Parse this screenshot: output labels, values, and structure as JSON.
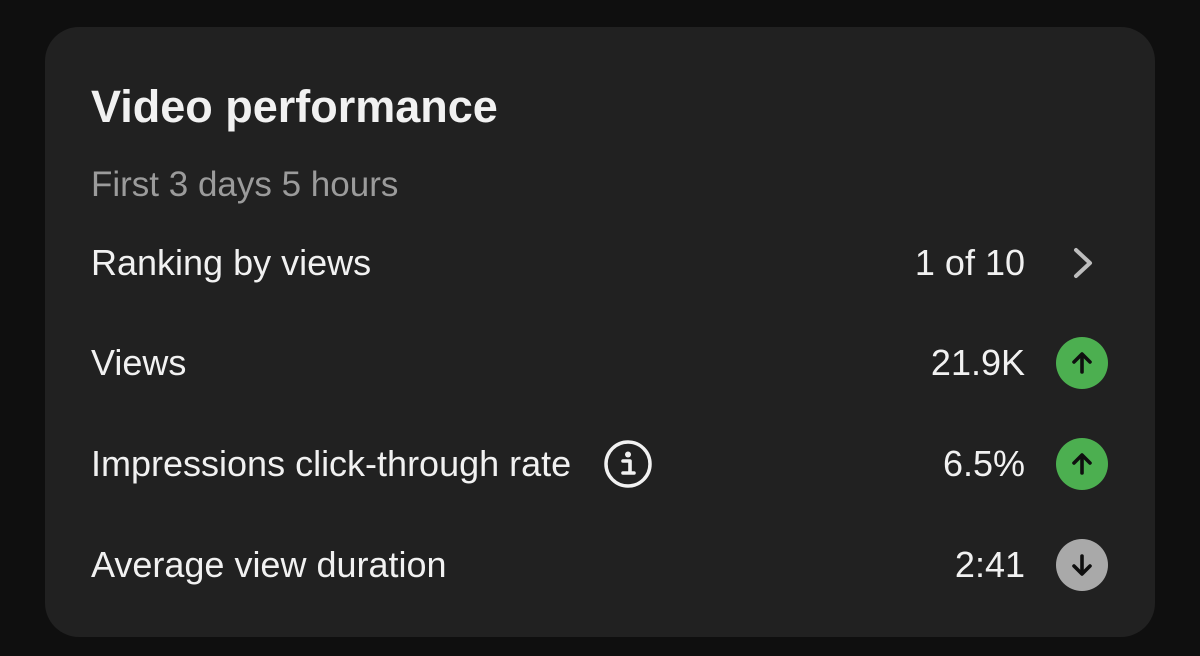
{
  "card": {
    "title": "Video performance",
    "subtitle": "First 3 days 5 hours"
  },
  "rows": [
    {
      "label": "Ranking by views",
      "value": "1 of 10",
      "icon": "chevron-right-icon"
    },
    {
      "label": "Views",
      "value": "21.9K",
      "trend": "up",
      "icon": "arrow-up-icon"
    },
    {
      "label": "Impressions click-through rate",
      "value": "6.5%",
      "trend": "up",
      "icon": "arrow-up-icon",
      "info_icon": "info-icon"
    },
    {
      "label": "Average view duration",
      "value": "2:41",
      "trend": "down",
      "icon": "arrow-down-icon"
    }
  ],
  "colors": {
    "background": "#0f0f0f",
    "card": "#212121",
    "text_primary": "#f1f1f1",
    "text_secondary": "#9b9b9b",
    "trend_up": "#4caf50",
    "trend_down": "#a9a9a9"
  }
}
